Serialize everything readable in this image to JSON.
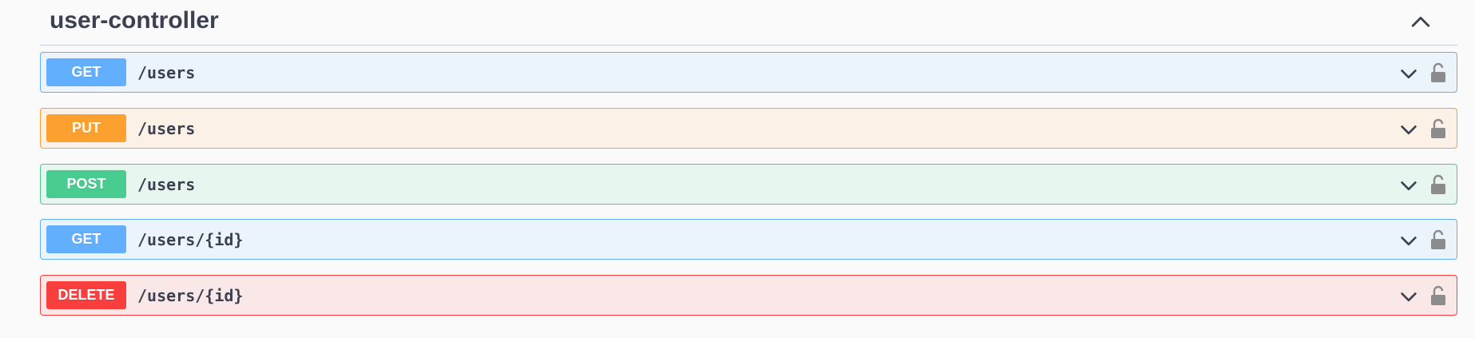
{
  "section": {
    "title": "user-controller",
    "collapse_icon": "chevron-up-icon"
  },
  "operations": [
    {
      "method": "GET",
      "path": "/users",
      "bg": "#ebf3fb",
      "border": "#61affe",
      "badge": "#61affe"
    },
    {
      "method": "PUT",
      "path": "/users",
      "bg": "#fbf1e6",
      "border": "#fca130",
      "badge": "#fca130"
    },
    {
      "method": "POST",
      "path": "/users",
      "bg": "#e8f6f0",
      "border": "#49cc90",
      "badge": "#49cc90"
    },
    {
      "method": "GET",
      "path": "/users/{id}",
      "bg": "#ebf3fb",
      "border": "#61affe",
      "badge": "#61affe"
    },
    {
      "method": "DELETE",
      "path": "/users/{id}",
      "bg": "#fae7e7",
      "border": "#f93e3e",
      "badge": "#f93e3e"
    }
  ],
  "icons": {
    "expand": "chevron-down-icon",
    "auth": "unlocked-padlock-icon"
  },
  "colors": {
    "text": "#3b4151",
    "icon": "#8c8c8c"
  }
}
